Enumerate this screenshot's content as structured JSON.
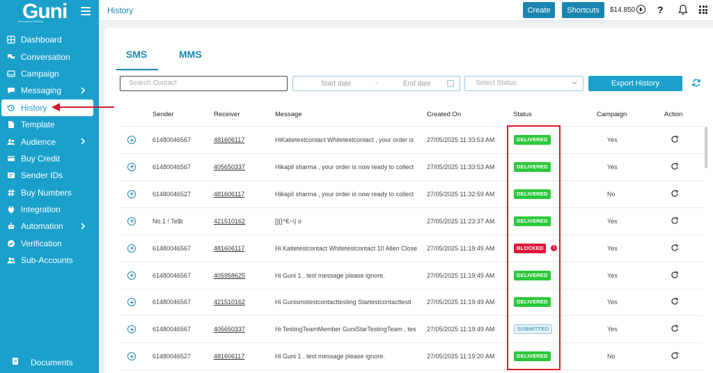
{
  "brand": {
    "name": "Guni",
    "tagline": "Messaging Gateway"
  },
  "sidebar": {
    "items": [
      {
        "label": "Dashboard",
        "icon": "grid-icon"
      },
      {
        "label": "Conversation",
        "icon": "chat-bubbles-icon"
      },
      {
        "label": "Campaign",
        "icon": "inbox-icon"
      },
      {
        "label": "Messaging",
        "icon": "message-icon",
        "has_submenu": true
      },
      {
        "label": "History",
        "icon": "history-icon",
        "active": true
      },
      {
        "label": "Template",
        "icon": "document-icon"
      },
      {
        "label": "Audience",
        "icon": "users-icon",
        "has_submenu": true
      },
      {
        "label": "Buy Credit",
        "icon": "credit-card-icon"
      },
      {
        "label": "Sender IDs",
        "icon": "id-card-icon"
      },
      {
        "label": "Buy Numbers",
        "icon": "hash-icon"
      },
      {
        "label": "Integration",
        "icon": "plug-icon"
      },
      {
        "label": "Automation",
        "icon": "robot-icon",
        "has_submenu": true
      },
      {
        "label": "Verification",
        "icon": "check-circle-icon"
      },
      {
        "label": "Sub-Accounts",
        "icon": "user-group-icon"
      }
    ],
    "documents_label": "Documents"
  },
  "topbar": {
    "title": "History",
    "create_label": "Create",
    "shortcuts_label": "Shortcuts",
    "balance": "$14.850"
  },
  "tabs": {
    "sms": "SMS",
    "mms": "MMS"
  },
  "filters": {
    "search_placeholder": "Search Contact",
    "start_date": "Start date",
    "separator": "-",
    "end_date": "End date",
    "status_placeholder": "Select Status",
    "export_label": "Export History"
  },
  "table": {
    "headers": [
      "Sender",
      "Receiver",
      "Message",
      "Created On",
      "Status",
      "Campaign",
      "Action"
    ],
    "rows": [
      {
        "sender": "61480046567",
        "receiver": "481606117",
        "message": "HiKatietestcontact Whitetestcontact , your order is",
        "created": "27/05/2025 11:33:53 AM",
        "status": "DELIVERED",
        "campaign": "Yes"
      },
      {
        "sender": "61480046567",
        "receiver": "405650337",
        "message": "Hikapil sharma , your order is now ready to collect",
        "created": "27/05/2025 11:33:53 AM",
        "status": "DELIVERED",
        "campaign": "Yes"
      },
      {
        "sender": "61480046527",
        "receiver": "481606117",
        "message": "Hikapil sharma , your order is now ready to collect",
        "created": "27/05/2025 11:32:59 AM",
        "status": "DELIVERED",
        "campaign": "No"
      },
      {
        "sender": "No.1 ! Te$t",
        "receiver": "421510162",
        "message": "[]{}^€~\\| o",
        "created": "27/05/2025 11:23:37 AM",
        "status": "DELIVERED",
        "campaign": "Yes"
      },
      {
        "sender": "61480046567",
        "receiver": "481606117",
        "message": "Hi Katietestcontact Whitetestcontact 10 Allen Close",
        "created": "27/05/2025 11:19:49 AM",
        "status": "BLOCKED",
        "campaign": "Yes"
      },
      {
        "sender": "61480046567",
        "receiver": "405958625",
        "message": "Hi Guni 1 . test message please ignore.",
        "created": "27/05/2025 11:19:49 AM",
        "status": "DELIVERED",
        "campaign": "Yes"
      },
      {
        "sender": "61480046567",
        "receiver": "421510162",
        "message": "Hi Gunismstestcontacttesting Startestcontacttesti",
        "created": "27/05/2025 11:19:49 AM",
        "status": "DELIVERED",
        "campaign": "Yes"
      },
      {
        "sender": "61480046567",
        "receiver": "405650337",
        "message": "Hi TestingTeamMember GuniStarTestingTeam , tes",
        "created": "27/05/2025 11:19:49 AM",
        "status": "SUBMITTED",
        "campaign": "Yes"
      },
      {
        "sender": "61480046527",
        "receiver": "481606117",
        "message": "Hi Guni 1 . test message please ignore.",
        "created": "27/05/2025 11:19:20 AM",
        "status": "DELIVERED",
        "campaign": "No"
      }
    ]
  },
  "colors": {
    "sidebar": "#1aa0cb",
    "primary": "#1a86b0",
    "delivered": "#2bc83a",
    "blocked": "#e0193b",
    "annotation": "#d9182a"
  }
}
